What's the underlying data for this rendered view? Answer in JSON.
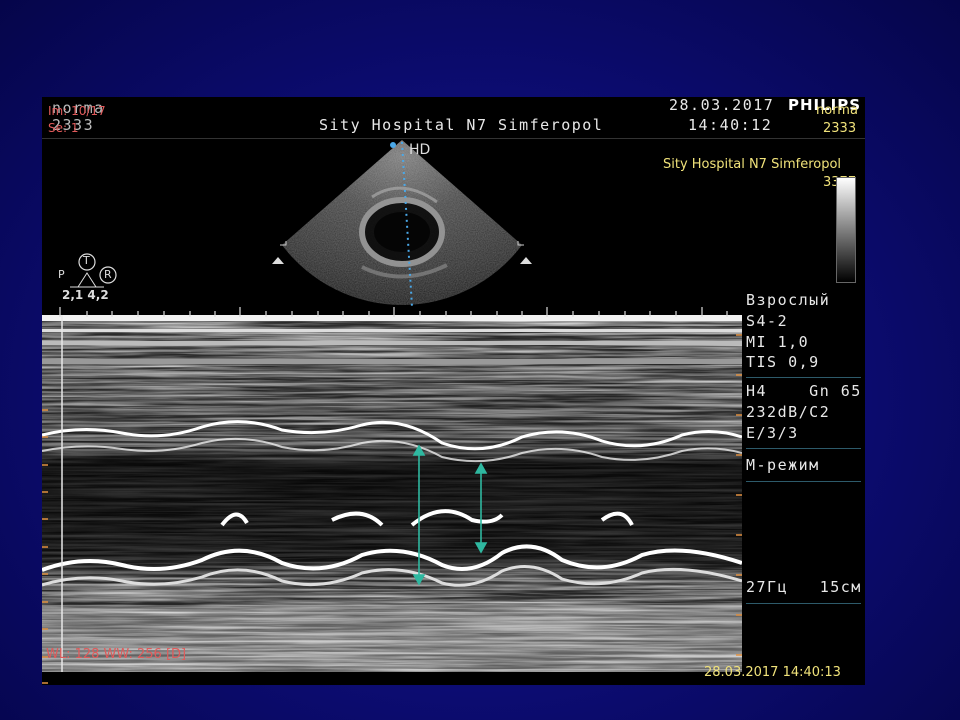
{
  "header": {
    "preset": "norma",
    "image_id": "2333",
    "image_no": "Im: 10/17",
    "series": "Se: 1",
    "hospital": "Sity Hospital N7 Simferopol",
    "date": "28.03.2017",
    "time": "14:40:12",
    "brand": "PHILIPS"
  },
  "right_overlay": {
    "preset": "norma",
    "id": "2333",
    "hospital": "Sity Hospital N7 Simferopol",
    "patient_id": "3377"
  },
  "image_labels": {
    "sector_label": "HD",
    "probe_t": "T",
    "probe_p": "P",
    "probe_r": "R",
    "probe_values": "2,1  4,2"
  },
  "side_panel": {
    "group1": [
      "Взрослый",
      "S4-2",
      "MI 1,0",
      "TIS 0,9"
    ],
    "group2": [
      "H4    Gn 65",
      "232dB/C2",
      "E/3/3"
    ],
    "mode": "М-режим",
    "rate_depth": "27Гц   15см"
  },
  "footer": {
    "window_level": "WL: 128 WW: 256 [D]",
    "timestamp": "28.03.2017 14:40:13"
  },
  "colors": {
    "background": "#0d0d78",
    "frame": "#000000",
    "header_text": "#e8e8e8",
    "overlay_red": "#e05a5a",
    "overlay_yellow": "#f0e27a",
    "caliper": "#2fb8a0",
    "cursor_line": "#4aa8e8"
  }
}
